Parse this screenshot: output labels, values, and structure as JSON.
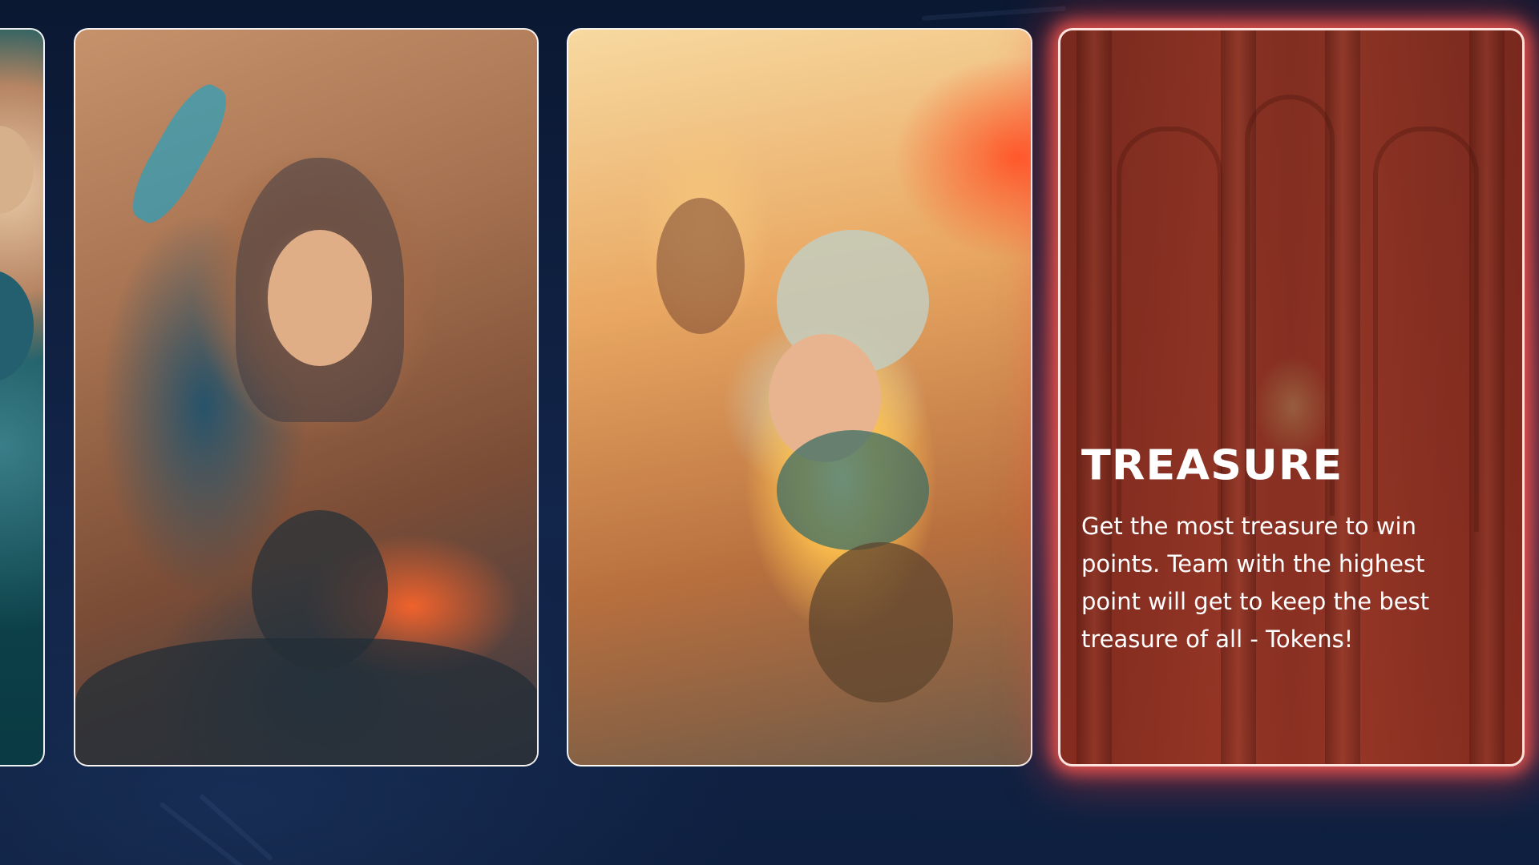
{
  "carousel": {
    "cards": [
      {
        "image": "partial-hero-art"
      },
      {
        "image": "hooded-archer-group-art"
      },
      {
        "image": "ponytail-warrior-flames-art"
      },
      {
        "title": "TREASURE",
        "description": "Get the most treasure to win points. Team with the highest point will get to keep the best treasure of all - Tokens!",
        "active": true,
        "image": "temple-hall-art"
      }
    ]
  },
  "colors": {
    "background": "#0d1a33",
    "active_glow": "#ff5a50",
    "card_border": "#ffffff"
  }
}
